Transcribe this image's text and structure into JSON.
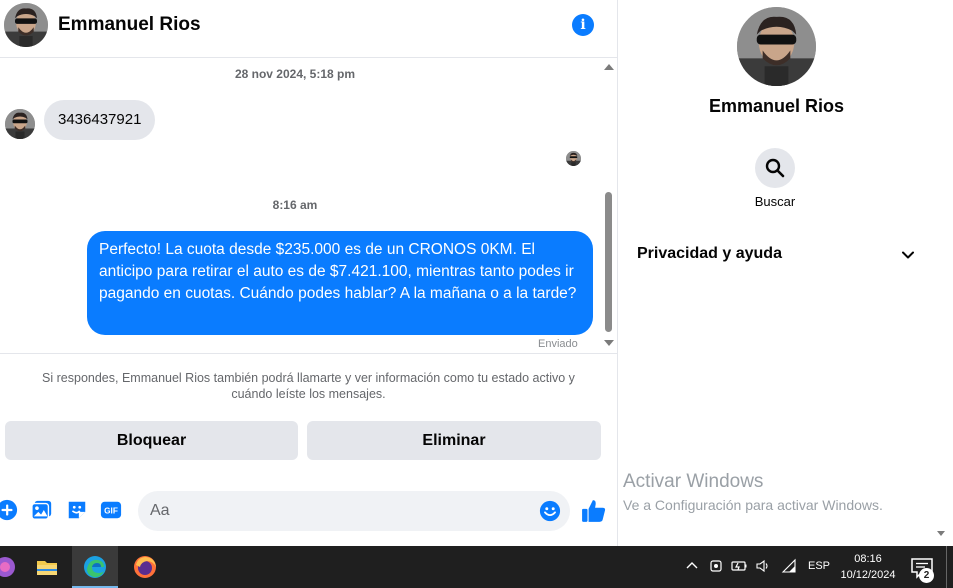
{
  "contact": {
    "name": "Emmanuel Rios"
  },
  "thread": {
    "timestamp_1": "28 nov 2024, 5:18 pm",
    "incoming_message": "3436437921",
    "timestamp_2": "8:16 am",
    "outgoing_message": "Perfecto! La cuota desde $235.000 es de un CRONOS 0KM. El anticipo para retirar el auto es de $7.421.100, mientras tanto podes ir pagando en cuotas. Cuándo podes hablar? A la mañana o a la tarde?",
    "status": "Enviado"
  },
  "notice": {
    "text": "Si respondes, Emmanuel Rios también podrá llamarte y ver información como tu estado activo y cuándo leíste los mensajes."
  },
  "actions": {
    "block_label": "Bloquear",
    "delete_label": "Eliminar"
  },
  "composer": {
    "placeholder": "Aa",
    "gif_label": "GIF"
  },
  "panel": {
    "name": "Emmanuel Rios",
    "search_label": "Buscar",
    "privacy_label": "Privacidad y ayuda",
    "watermark_title": "Activar Windows",
    "watermark_sub": "Ve a Configuración para activar Windows."
  },
  "taskbar": {
    "language": "ESP",
    "time": "08:16",
    "date": "10/12/2024",
    "notification_count": "2"
  },
  "colors": {
    "accent": "#0a7cff",
    "bubble_in": "#e4e6eb",
    "taskbar": "#1f1f1f"
  },
  "icons": [
    "info-icon",
    "plus-icon",
    "photo-icon",
    "sticker-icon",
    "gif-icon",
    "emoji-icon",
    "like-icon",
    "search-icon",
    "chevron-down-icon",
    "edge-icon",
    "firefox-icon",
    "file-explorer-icon",
    "notification-icon"
  ]
}
